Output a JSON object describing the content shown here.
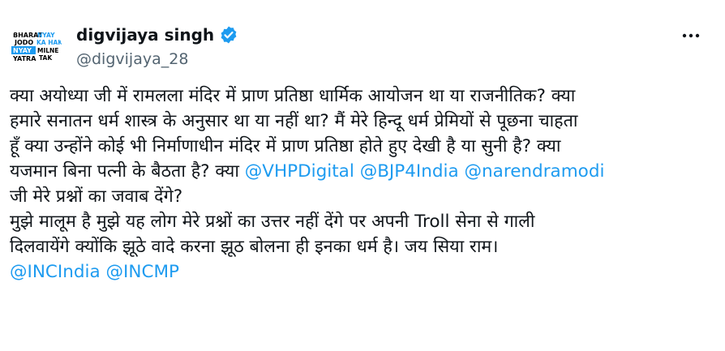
{
  "author": {
    "name": "digvijaya singh",
    "handle": "@digvijaya_28",
    "avatar_text": [
      "BHARAT",
      "JODO",
      "NYAY",
      "YATRA",
      "NYAY",
      "KA HAK",
      "MILNE",
      "TAK"
    ]
  },
  "colors": {
    "mention": "#1d9bf0",
    "verified": "#1d9bf0",
    "text": "#0f1419",
    "secondary": "#536471"
  },
  "icons": {
    "verified": "verified-badge-icon",
    "more": "more-options-icon"
  },
  "body": {
    "line1": "क्या अयोध्या जी में रामलला मंदिर में प्राण प्रतिष्ठा धार्मिक आयोजन था या राजनीतिक? क्या",
    "line2": "हमारे सनातन धर्म शास्त्र के अनुसार था या नहीं था? मैं मेरे हिन्दू धर्म प्रेमियों से पूछना चाहता",
    "line3": "हूँ क्या उन्होंने कोई भी निर्माणाधीन मंदिर में प्राण प्रतिष्ठा होते हुए देखी है या सुनी है? क्या",
    "line4_text": "यजमान बिना पत्नी के बैठता है? क्या ",
    "mention_vhp": "@VHPDigital",
    "mention_bjp": "@BJP4India",
    "mention_modi": "@narendramodi",
    "line5": "जी मेरे प्रश्नों का जवाब देंगे?",
    "line6": "मुझे मालूम है मुझे यह लोग मेरे प्रश्नों का उत्तर नहीं देंगे पर अपनी Troll सेना से गाली",
    "line7": "दिलवायेंगे क्योंकि झूठे वादे करना झूठ बोलना ही इनका धर्म है। जय सिया राम।",
    "mention_inc": "@INCIndia",
    "mention_incmp": "@INCMP"
  }
}
